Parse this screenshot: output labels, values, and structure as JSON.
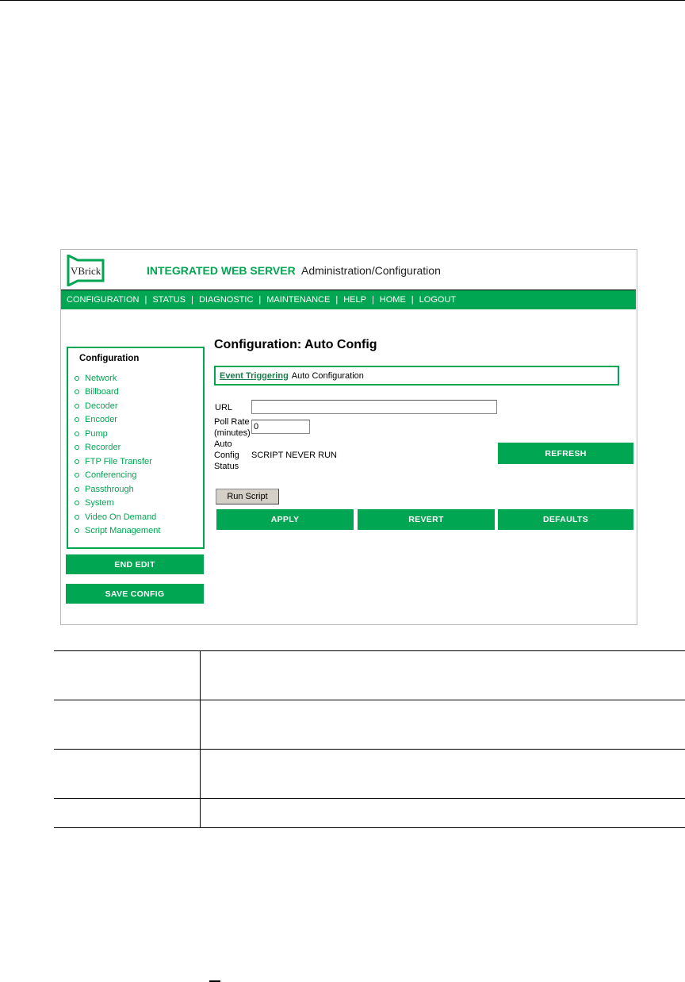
{
  "header": {
    "logo_text": "VBrick",
    "title": "INTEGRATED WEB SERVER",
    "subtitle": "Administration/Configuration"
  },
  "nav": [
    "CONFIGURATION",
    "STATUS",
    "DIAGNOSTIC",
    "MAINTENANCE",
    "HELP",
    "HOME",
    "LOGOUT"
  ],
  "nav_separator": "|",
  "sidebar": {
    "heading": "Configuration",
    "items": [
      "Network",
      "Billboard",
      "Decoder",
      "Encoder",
      "Pump",
      "Recorder",
      "FTP File Transfer",
      "Conferencing",
      "Passthrough",
      "System",
      "Video On Demand",
      "Script Management"
    ],
    "end_edit": "END EDIT",
    "save_config": "SAVE CONFIG"
  },
  "main": {
    "title": "Configuration: Auto Config",
    "breadcrumb_link": "Event Triggering",
    "breadcrumb_current": "Auto Configuration",
    "url_label": "URL",
    "url_value": "",
    "poll_label_1": "Poll Rate",
    "poll_label_2": "(minutes)",
    "poll_value": "0",
    "status_label_1": "Auto",
    "status_label_2": "Config",
    "status_label_3": "Status",
    "status_value": "SCRIPT NEVER RUN",
    "refresh": "REFRESH",
    "run_script": "Run Script",
    "apply": "APPLY",
    "revert": "REVERT",
    "defaults": "DEFAULTS"
  },
  "colors": {
    "brand_green": "#00a651"
  }
}
